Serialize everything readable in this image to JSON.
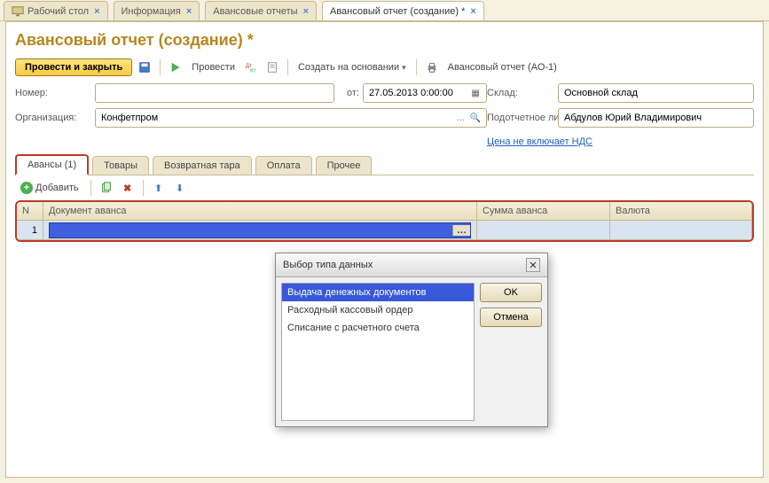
{
  "tabs": [
    {
      "label": "Рабочий стол",
      "icon": "desktop"
    },
    {
      "label": "Информация"
    },
    {
      "label": "Авансовые отчеты"
    },
    {
      "label": "Авансовый отчет (создание) *",
      "active": true
    }
  ],
  "page": {
    "title": "Авансовый отчет (создание) *"
  },
  "toolbar": {
    "submit_close": "Провести и закрыть",
    "submit": "Провести",
    "create_based": "Создать на основании",
    "print_form": "Авансовый отчет (АО-1)"
  },
  "form": {
    "number_label": "Номер:",
    "number_value": "",
    "from_label": "от:",
    "date_value": "27.05.2013 0:00:00",
    "warehouse_label": "Склад:",
    "warehouse_value": "Основной склад",
    "org_label": "Организация:",
    "org_value": "Конфетпром",
    "person_label": "Подотчетное лицо:",
    "person_value": "Абдулов Юрий Владимирович",
    "vat_link": "Цена не включает НДС"
  },
  "subtabs": [
    {
      "label": "Авансы (1)",
      "active": true
    },
    {
      "label": "Товары"
    },
    {
      "label": "Возвратная тара"
    },
    {
      "label": "Оплата"
    },
    {
      "label": "Прочее"
    }
  ],
  "rowtoolbar": {
    "add": "Добавить"
  },
  "columns": {
    "n": "N",
    "doc": "Документ аванса",
    "sum": "Сумма аванса",
    "cur": "Валюта"
  },
  "rows": [
    {
      "n": "1",
      "doc": "",
      "sum": "",
      "cur": ""
    }
  ],
  "dialog": {
    "title": "Выбор типа данных",
    "ok": "OK",
    "cancel": "Отмена",
    "items": [
      {
        "label": "Выдача денежных документов",
        "selected": true
      },
      {
        "label": "Расходный кассовый ордер"
      },
      {
        "label": "Списание с расчетного счета"
      }
    ]
  }
}
